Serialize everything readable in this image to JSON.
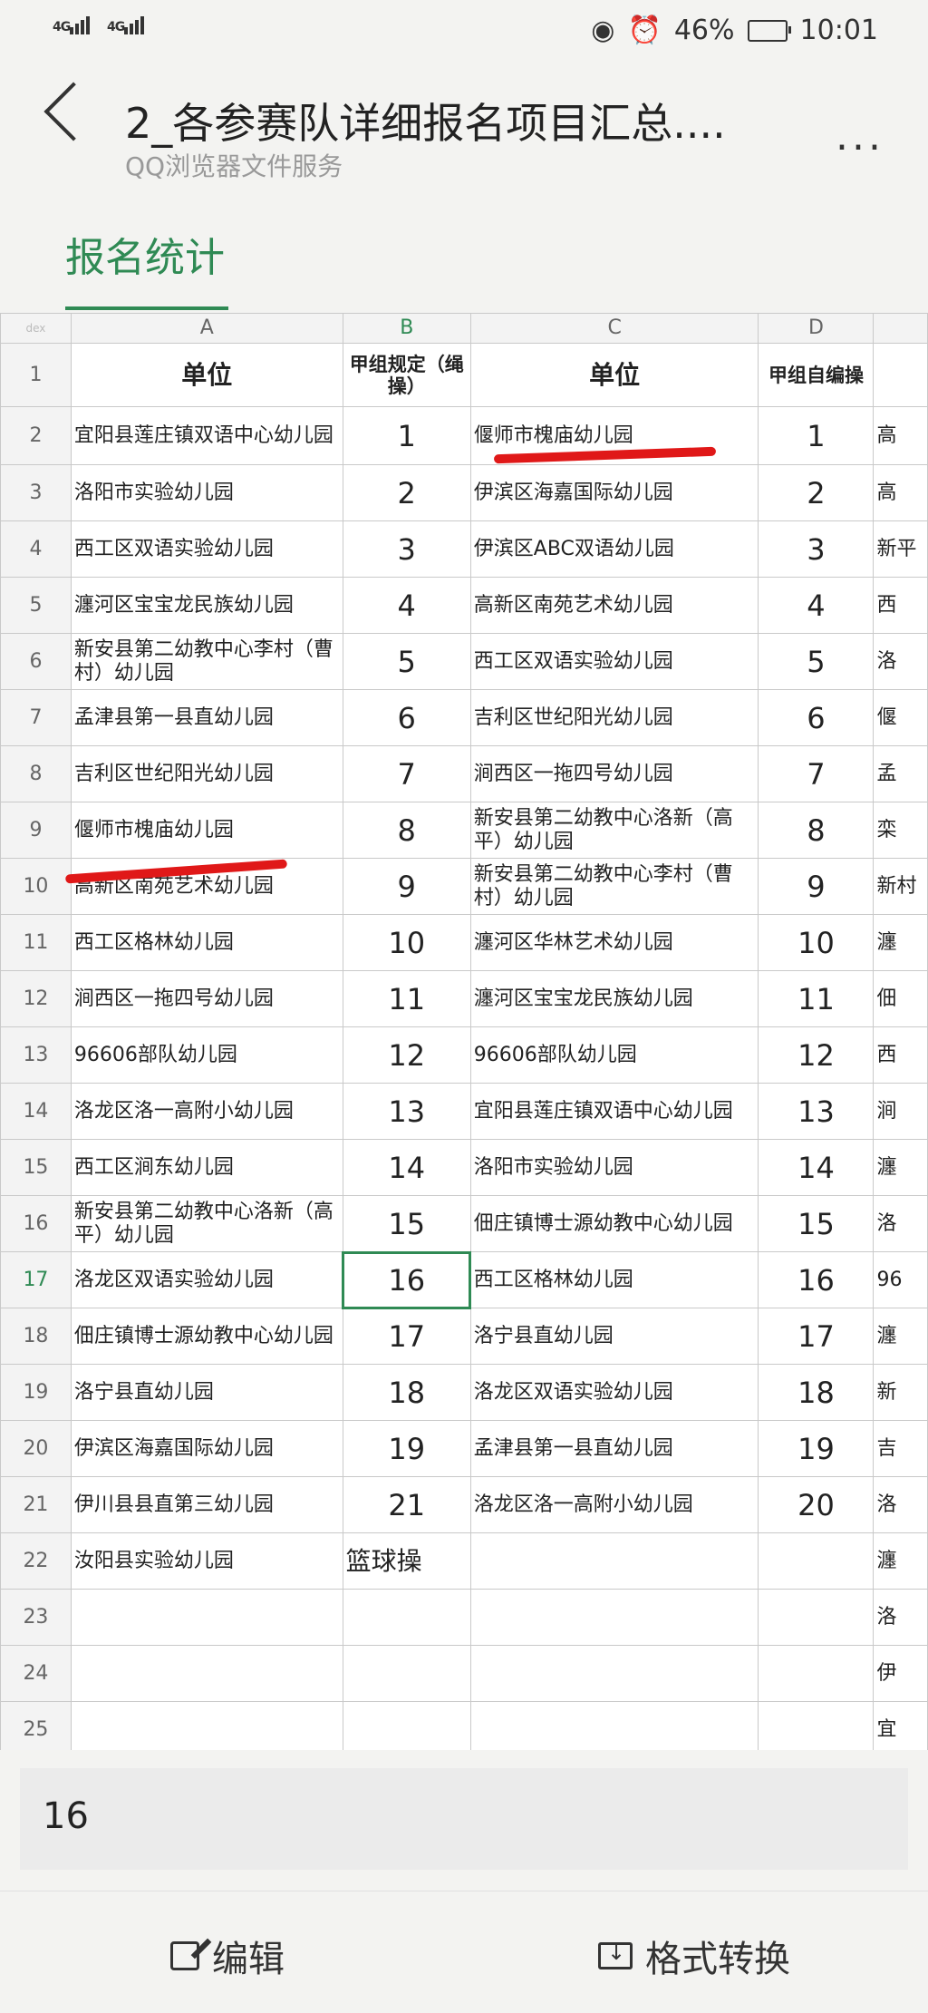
{
  "status_bar": {
    "signal1": "4G",
    "signal2": "4G",
    "battery": "46%",
    "time": "10:01"
  },
  "header": {
    "title": "2_各参赛队详细报名项目汇总....",
    "subtitle": "QQ浏览器文件服务",
    "more": "..."
  },
  "sheet_tab": "报名统计",
  "columns": [
    "A",
    "B",
    "C",
    "D"
  ],
  "corner": "dex",
  "header_row": {
    "a": "单位",
    "b": "甲组规定（绳操）",
    "c": "单位",
    "d": "甲组自编操"
  },
  "rows": [
    {
      "n": "2",
      "a": "宜阳县莲庄镇双语中心幼儿园",
      "b": "1",
      "c": "偃师市槐庙幼儿园",
      "d": "1",
      "e": "高"
    },
    {
      "n": "3",
      "a": "洛阳市实验幼儿园",
      "b": "2",
      "c": "伊滨区海嘉国际幼儿园",
      "d": "2",
      "e": "高"
    },
    {
      "n": "4",
      "a": "西工区双语实验幼儿园",
      "b": "3",
      "c": "伊滨区ABC双语幼儿园",
      "d": "3",
      "e": "新平"
    },
    {
      "n": "5",
      "a": "瀍河区宝宝龙民族幼儿园",
      "b": "4",
      "c": "高新区南苑艺术幼儿园",
      "d": "4",
      "e": "西"
    },
    {
      "n": "6",
      "a": "新安县第二幼教中心李村（曹村）幼儿园",
      "b": "5",
      "c": "西工区双语实验幼儿园",
      "d": "5",
      "e": "洛"
    },
    {
      "n": "7",
      "a": "孟津县第一县直幼儿园",
      "b": "6",
      "c": "吉利区世纪阳光幼儿园",
      "d": "6",
      "e": "偃"
    },
    {
      "n": "8",
      "a": "吉利区世纪阳光幼儿园",
      "b": "7",
      "c": "涧西区一拖四号幼儿园",
      "d": "7",
      "e": "孟"
    },
    {
      "n": "9",
      "a": "偃师市槐庙幼儿园",
      "b": "8",
      "c": "新安县第二幼教中心洛新（高平）幼儿园",
      "d": "8",
      "e": "栾"
    },
    {
      "n": "10",
      "a": "高新区南苑艺术幼儿园",
      "b": "9",
      "c": "新安县第二幼教中心李村（曹村）幼儿园",
      "d": "9",
      "e": "新村"
    },
    {
      "n": "11",
      "a": "西工区格林幼儿园",
      "b": "10",
      "c": "瀍河区华林艺术幼儿园",
      "d": "10",
      "e": "瀍"
    },
    {
      "n": "12",
      "a": "涧西区一拖四号幼儿园",
      "b": "11",
      "c": "瀍河区宝宝龙民族幼儿园",
      "d": "11",
      "e": "佃"
    },
    {
      "n": "13",
      "a": "96606部队幼儿园",
      "b": "12",
      "c": "96606部队幼儿园",
      "d": "12",
      "e": "西"
    },
    {
      "n": "14",
      "a": "洛龙区洛一高附小幼儿园",
      "b": "13",
      "c": "宜阳县莲庄镇双语中心幼儿园",
      "d": "13",
      "e": "涧"
    },
    {
      "n": "15",
      "a": "西工区涧东幼儿园",
      "b": "14",
      "c": "洛阳市实验幼儿园",
      "d": "14",
      "e": "瀍"
    },
    {
      "n": "16",
      "a": "新安县第二幼教中心洛新（高平）幼儿园",
      "b": "15",
      "c": "佃庄镇博士源幼教中心幼儿园",
      "d": "15",
      "e": "洛"
    },
    {
      "n": "17",
      "a": "洛龙区双语实验幼儿园",
      "b": "16",
      "c": "西工区格林幼儿园",
      "d": "16",
      "e": "96"
    },
    {
      "n": "18",
      "a": "佃庄镇博士源幼教中心幼儿园",
      "b": "17",
      "c": "洛宁县直幼儿园",
      "d": "17",
      "e": "瀍"
    },
    {
      "n": "19",
      "a": "洛宁县直幼儿园",
      "b": "18",
      "c": "洛龙区双语实验幼儿园",
      "d": "18",
      "e": "新"
    },
    {
      "n": "20",
      "a": "伊滨区海嘉国际幼儿园",
      "b": "19",
      "c": "孟津县第一县直幼儿园",
      "d": "19",
      "e": "吉"
    },
    {
      "n": "21",
      "a": "伊川县县直第三幼儿园",
      "b": "21",
      "c": "洛龙区洛一高附小幼儿园",
      "d": "20",
      "e": "洛"
    },
    {
      "n": "22",
      "a": "汝阳县实验幼儿园",
      "b": "篮球操",
      "c": "",
      "d": "",
      "e": "瀍"
    },
    {
      "n": "23",
      "a": "",
      "b": "",
      "c": "",
      "d": "",
      "e": "洛"
    },
    {
      "n": "24",
      "a": "",
      "b": "",
      "c": "",
      "d": "",
      "e": "伊"
    },
    {
      "n": "25",
      "a": "",
      "b": "",
      "c": "",
      "d": "",
      "e": "宜"
    }
  ],
  "selected": {
    "row": "17",
    "column": "B",
    "formula_value": "16"
  },
  "bottom_bar": {
    "edit": "编辑",
    "convert": "格式转换"
  },
  "colors": {
    "accent": "#2f8a54",
    "annotation": "#e01818"
  }
}
